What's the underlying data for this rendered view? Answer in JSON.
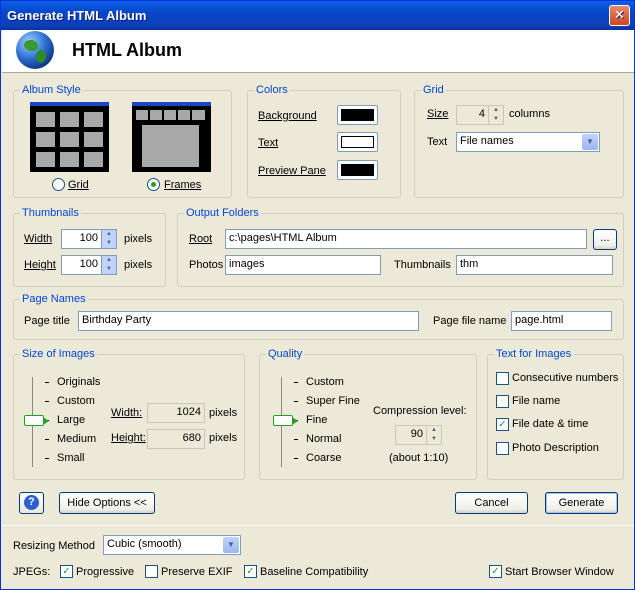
{
  "window": {
    "title": "Generate HTML Album",
    "close_label": "✕"
  },
  "header": {
    "title": "HTML Album"
  },
  "album_style": {
    "legend": "Album Style",
    "grid_label": "Grid",
    "frames_label": "Frames",
    "selected": "Frames"
  },
  "colors": {
    "legend": "Colors",
    "background_label": "Background",
    "text_label": "Text",
    "preview_label": "Preview Pane",
    "background_color": "#000000",
    "text_color": "#ffffff",
    "preview_color": "#000000"
  },
  "grid": {
    "legend": "Grid",
    "size_label": "Size",
    "size_value": "4",
    "columns_label": "columns",
    "text_label": "Text",
    "text_value": "File names"
  },
  "thumbnails": {
    "legend": "Thumbnails",
    "width_label": "Width",
    "width_value": "100",
    "height_label": "Height",
    "height_value": "100",
    "unit": "pixels"
  },
  "output_folders": {
    "legend": "Output Folders",
    "root_label": "Root",
    "root_value": "c:\\pages\\HTML Album",
    "browse_label": "...",
    "photos_label": "Photos",
    "photos_value": "images",
    "thumbnails_label": "Thumbnails",
    "thumbnails_value": "thm"
  },
  "page_names": {
    "legend": "Page Names",
    "title_label": "Page title",
    "title_value": "Birthday Party",
    "file_label": "Page file name",
    "file_value": "page.html"
  },
  "size_of_images": {
    "legend": "Size of Images",
    "levels": [
      "Originals",
      "Custom",
      "Large",
      "Medium",
      "Small"
    ],
    "selected": "Large",
    "width_label": "Width:",
    "width_value": "1024",
    "height_label": "Height:",
    "height_value": "680",
    "unit": "pixels"
  },
  "quality": {
    "legend": "Quality",
    "levels": [
      "Custom",
      "Super Fine",
      "Fine",
      "Normal",
      "Coarse"
    ],
    "selected": "Fine",
    "compression_label": "Compression level:",
    "compression_value": "90",
    "ratio_label": "(about 1:10)"
  },
  "text_for_images": {
    "legend": "Text for Images",
    "options": [
      {
        "label": "Consecutive numbers",
        "checked": false
      },
      {
        "label": "File name",
        "checked": false
      },
      {
        "label": "File date & time",
        "checked": true
      },
      {
        "label": "Photo Description",
        "checked": false
      }
    ]
  },
  "actions": {
    "help_label": "?",
    "hide_options_label": "Hide Options <<",
    "cancel_label": "Cancel",
    "generate_label": "Generate"
  },
  "footer": {
    "resizing_label": "Resizing Method",
    "resizing_value": "Cubic (smooth)",
    "jpegs_label": "JPEGs:",
    "progressive_label": "Progressive",
    "progressive_checked": true,
    "preserve_exif_label": "Preserve EXIF",
    "preserve_exif_checked": false,
    "baseline_label": "Baseline Compatibility",
    "baseline_checked": true,
    "start_browser_label": "Start Browser Window",
    "start_browser_checked": true
  }
}
